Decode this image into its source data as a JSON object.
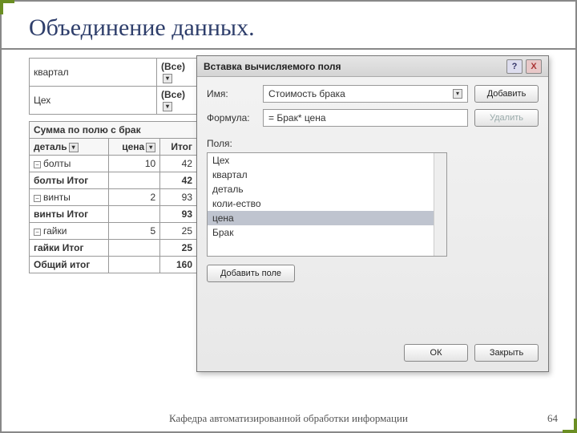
{
  "slide": {
    "title": "Объединение данных.",
    "footer": "Кафедра автоматизированной обработки информации",
    "page": "64"
  },
  "pivot": {
    "filters": [
      {
        "label": "квартал",
        "value": "(Все)"
      },
      {
        "label": "Цех",
        "value": "(Все)"
      }
    ],
    "sumLabel": "Сумма по полю с брак",
    "rowHeader": "деталь",
    "colHeaders": [
      "цена",
      "Итог"
    ],
    "rows": [
      {
        "label": "болты",
        "v1": "10",
        "v2": "42",
        "expand": true
      },
      {
        "label": "болты Итог",
        "v1": "",
        "v2": "42",
        "bold": true
      },
      {
        "label": "винты",
        "v1": "2",
        "v2": "93",
        "expand": true
      },
      {
        "label": "винты Итог",
        "v1": "",
        "v2": "93",
        "bold": true
      },
      {
        "label": "гайки",
        "v1": "5",
        "v2": "25",
        "expand": true
      },
      {
        "label": "гайки Итог",
        "v1": "",
        "v2": "25",
        "bold": true
      },
      {
        "label": "Общий итог",
        "v1": "",
        "v2": "160",
        "bold": true
      }
    ]
  },
  "dialog": {
    "title": "Вставка вычисляемого поля",
    "nameLabel": "Имя:",
    "nameValue": "Стоимость брака",
    "formulaLabel": "Формула:",
    "formulaValue": "= Брак* цена",
    "addBtn": "Добавить",
    "deleteBtn": "Удалить",
    "fieldsLabel": "Поля:",
    "fields": [
      "Цех",
      "квартал",
      "деталь",
      "коли-ество",
      "цена",
      "Брак"
    ],
    "addFieldBtn": "Добавить поле",
    "okBtn": "ОК",
    "closeBtn": "Закрыть"
  }
}
